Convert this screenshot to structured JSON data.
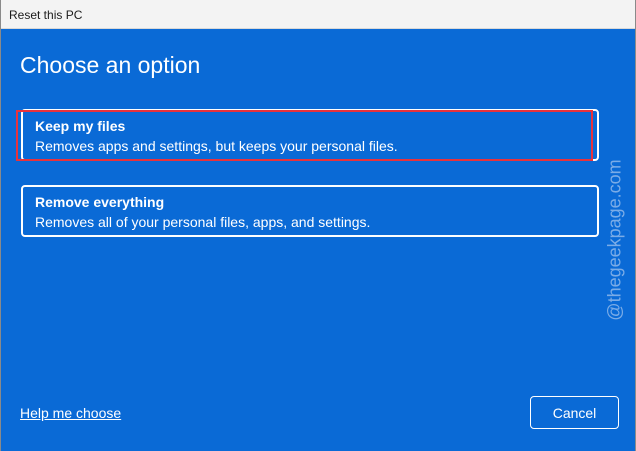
{
  "window": {
    "title": "Reset this PC"
  },
  "main": {
    "heading": "Choose an option",
    "options": [
      {
        "title": "Keep my files",
        "description": "Removes apps and settings, but keeps your personal files."
      },
      {
        "title": "Remove everything",
        "description": "Removes all of your personal files, apps, and settings."
      }
    ]
  },
  "footer": {
    "help_label": "Help me choose",
    "cancel_label": "Cancel"
  },
  "watermark": {
    "text": "@thegeekpage.com"
  },
  "colors": {
    "background": "#0a6ad6",
    "highlight": "#e8323c",
    "text": "#ffffff"
  }
}
